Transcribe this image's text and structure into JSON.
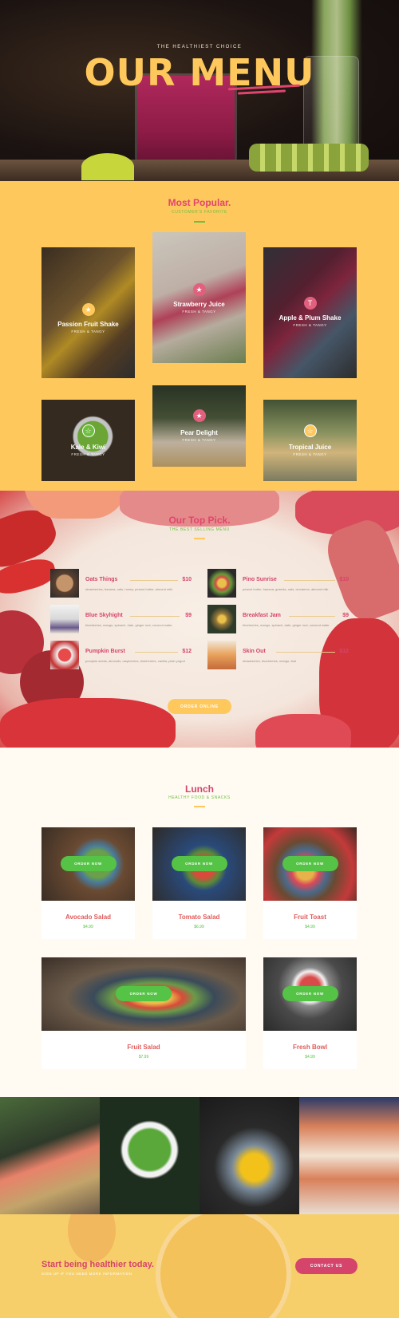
{
  "hero": {
    "pretitle": "THE HEALTHIEST CHOICE",
    "title": "OUR MENU"
  },
  "popular": {
    "title": "Most Popular.",
    "subtitle": "CUSTOMER'S FAVORITE",
    "items": [
      {
        "name": "Passion Fruit Shake",
        "tag": "FRESH & TANGY",
        "icon": "star-icon",
        "icon_color": "#ffc85c"
      },
      {
        "name": "Strawberry Juice",
        "tag": "FRESH & TANGY",
        "icon": "star-icon",
        "icon_color": "#e0607e"
      },
      {
        "name": "Apple & Plum Shake",
        "tag": "FRESH & TANGY",
        "icon": "drink-icon",
        "icon_color": "#e0607e"
      },
      {
        "name": "Kale & Kiwi",
        "tag": "FRESH & TANGY",
        "icon": "star-icon",
        "icon_color": "#6fbf3f"
      },
      {
        "name": "Pear Delight",
        "tag": "FRESH & TANGY",
        "icon": "star-icon",
        "icon_color": "#e0607e"
      },
      {
        "name": "Tropical Juice",
        "tag": "FRESH & TANGY",
        "icon": "star-icon",
        "icon_color": "#ffc85c"
      }
    ]
  },
  "toppick": {
    "title": "Our Top Pick.",
    "subtitle": "THE BEST SELLING MENU",
    "items": [
      {
        "name": "Oats Things",
        "price": "$10",
        "desc": "strawberries, banana, oats, honey, peanut butter, almond milk"
      },
      {
        "name": "Blue Skyhight",
        "price": "$9",
        "desc": "blueberries, mango, spinach, date, ginger root, coconut water"
      },
      {
        "name": "Pumpkin Burst",
        "price": "$12",
        "desc": "pumpkin seeds, almonds, raspberries, blueberries, vanilla, plain yogurt"
      },
      {
        "name": "Pino Sunrise",
        "price": "$10",
        "desc": "peanut butter, banana, granola, oats, cinnamon, almond milk"
      },
      {
        "name": "Breakfast Jam",
        "price": "$9",
        "desc": "blueberries, mango, spinach, date, ginger root, coconut water"
      },
      {
        "name": "Skin Out",
        "price": "$12",
        "desc": "strawberries, blueberries, mango, kiwi"
      }
    ],
    "order_label": "ORDER ONLINE"
  },
  "lunch": {
    "title": "Lunch",
    "subtitle": "HEALTHY FOOD & SNACKS",
    "order_label": "ORDER NOW",
    "items": [
      {
        "name": "Avocado Salad",
        "price": "$4.99"
      },
      {
        "name": "Tomato Salad",
        "price": "$6.99"
      },
      {
        "name": "Fruit Toast",
        "price": "$4.99"
      },
      {
        "name": "Fruit Salad",
        "price": "$7.99"
      },
      {
        "name": "Fresh Bowl",
        "price": "$4.99"
      }
    ]
  },
  "cta": {
    "heading": "Start being healthier today.",
    "subtext": "SIGN UP IF YOU NEED MORE INFORMATION",
    "button": "CONTACT US"
  },
  "colors": {
    "accent_pink": "#d5446a",
    "yellow": "#ffc85c",
    "green": "#55c345"
  }
}
